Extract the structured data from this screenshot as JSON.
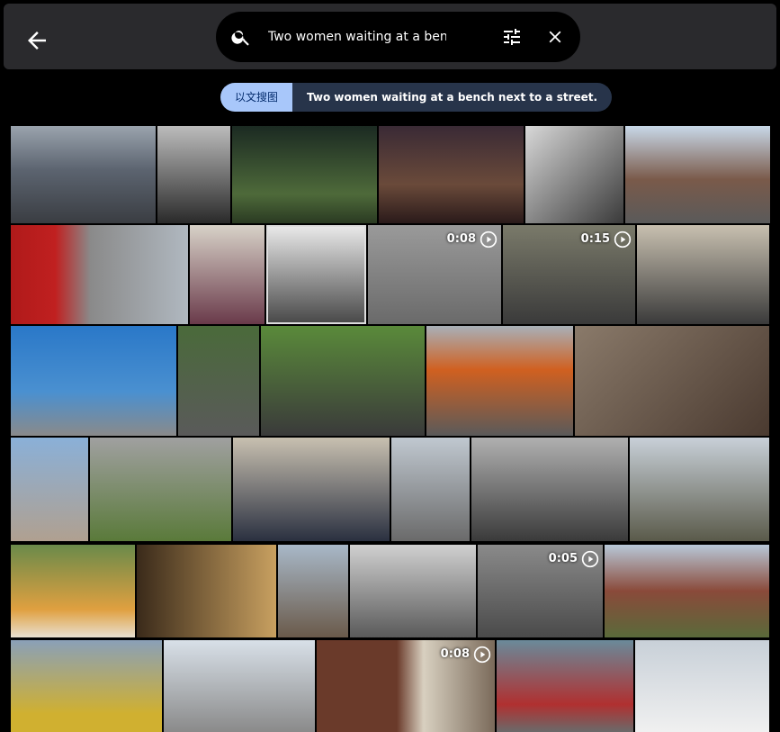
{
  "header": {
    "back_icon": "arrow-left-icon",
    "search_icon": "search-icon",
    "query": "Two women waiting at a bench next to",
    "filter_icon": "tune-icon",
    "clear_icon": "close-icon"
  },
  "chip": {
    "mode": "以文搜图",
    "text": "Two women waiting at a bench next to a street."
  },
  "results": {
    "durations": [
      "0:08",
      "0:15",
      "0:05",
      "0:08"
    ]
  },
  "colors": {
    "bar": "#2a2a2d",
    "chip_accent": "#a8c7fa",
    "chip_bg": "#27344a",
    "background": "#000000"
  }
}
